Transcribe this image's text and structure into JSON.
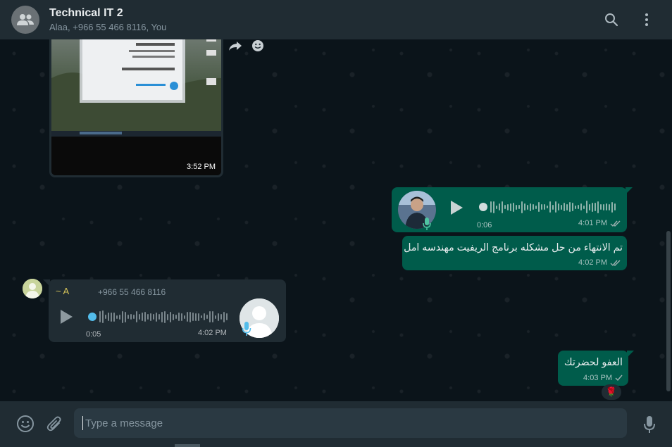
{
  "header": {
    "title": "Technical IT 2",
    "participants": "Alaa, +966 55 466 8116, You",
    "icons": [
      "group-avatar-icon",
      "search-icon",
      "menu-icon"
    ]
  },
  "messages": {
    "image_message": {
      "time": "3:52 PM"
    },
    "voice_out": {
      "duration": "0:06",
      "time": "4:01 PM",
      "status": "read"
    },
    "text_out_1": {
      "text": "تم الانتهاء من حل مشكله برنامج الريفيت مهندسه امل",
      "time": "4:02 PM",
      "status": "read"
    },
    "voice_in": {
      "sender_name": "~ A",
      "sender_phone": "+966 55 466 8116",
      "duration": "0:05",
      "time": "4:02 PM"
    },
    "text_out_2": {
      "text": "العفو لحضرتك",
      "time": "4:03 PM",
      "status": "sent",
      "reaction": "🌹"
    }
  },
  "composer": {
    "placeholder": "Type a message",
    "icons": [
      "emoji-icon",
      "attach-icon",
      "mic-icon"
    ]
  },
  "colors": {
    "header_bg": "#202c33",
    "chat_bg": "#0b141a",
    "outgoing_bubble": "#005c4b",
    "incoming_bubble": "#202c33",
    "accent": "#53bdeb"
  }
}
